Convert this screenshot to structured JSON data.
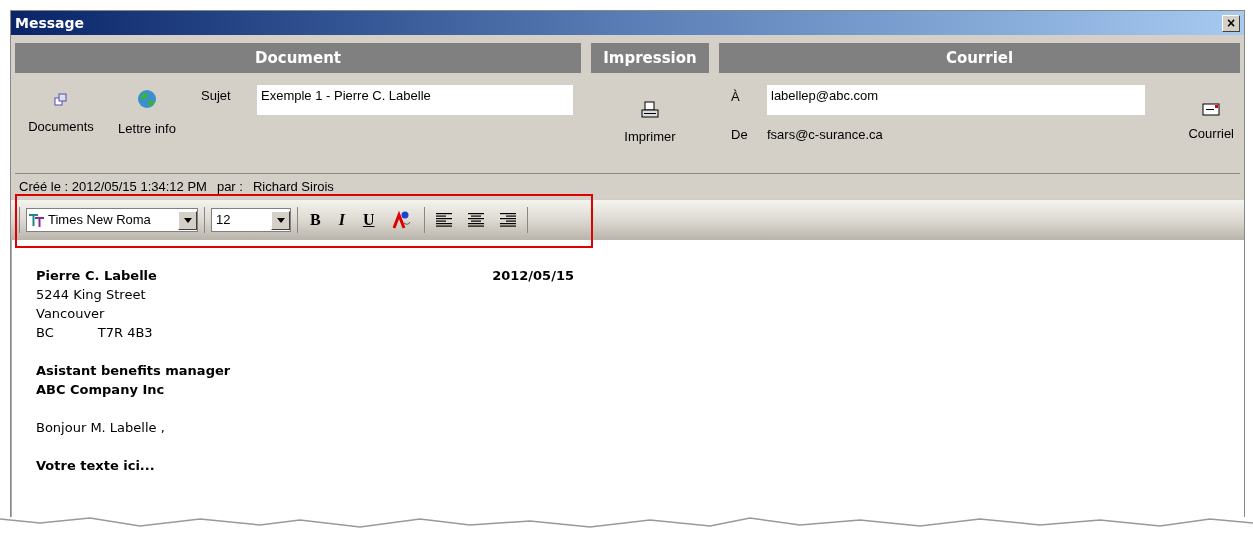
{
  "window": {
    "title": "Message",
    "close": "×"
  },
  "sections": [
    {
      "title": "Document"
    },
    {
      "title": "Impression"
    },
    {
      "title": "Courriel"
    }
  ],
  "document": {
    "buttons": [
      {
        "label": "Documents",
        "kind": "documents"
      },
      {
        "label": "Lettre info",
        "kind": "recycle"
      }
    ],
    "subject_label": "Sujet",
    "subject": "Exemple 1 - Pierre C. Labelle"
  },
  "print": {
    "label": "Imprimer"
  },
  "mail": {
    "to_label": "À",
    "to": "labellep@abc.com",
    "from_label": "De",
    "from": "fsars@c-surance.ca",
    "send_label": "Courriel"
  },
  "created": {
    "text": "Créé le : 2012/05/15 1:34:12 PM",
    "by_label": "par :",
    "by": "Richard Sirois"
  },
  "toolbar": {
    "highlighted": true,
    "font": "Times New Roma",
    "size": "12",
    "buttons": [
      {
        "kind": "bold",
        "label": "B"
      },
      {
        "kind": "italic",
        "label": "I"
      },
      {
        "kind": "underline",
        "label": "U"
      },
      {
        "kind": "spell"
      },
      {
        "kind": "align-left"
      },
      {
        "kind": "align-center"
      },
      {
        "kind": "align-right"
      }
    ]
  },
  "letter": {
    "name": "Pierre C. Labelle",
    "date": "2012/05/15",
    "address": [
      "5244 King Street",
      "Vancouver"
    ],
    "province": "BC",
    "postal": "T7R 4B3",
    "title": "Asistant benefits manager",
    "company": "ABC Company Inc",
    "greeting": "Bonjour M. Labelle ,",
    "body": "Votre texte ici..."
  }
}
